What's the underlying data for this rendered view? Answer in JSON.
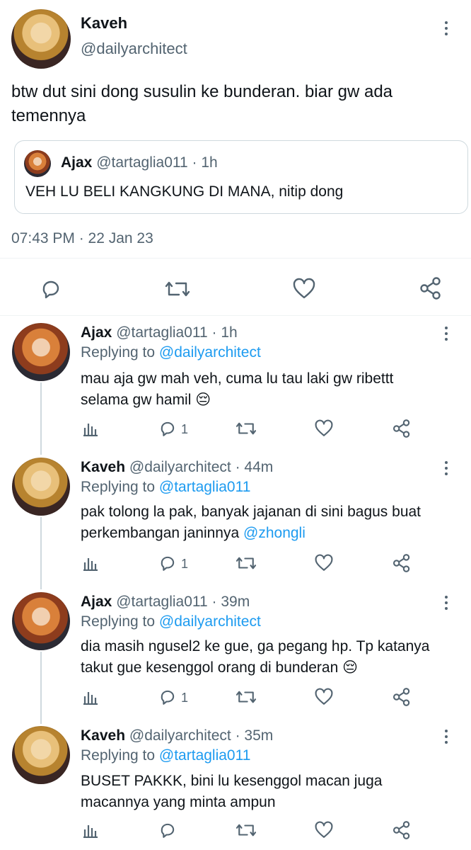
{
  "tweet": {
    "author_name": "Kaveh",
    "author_handle": "@dailyarchitect",
    "text": "btw dut sini dong susulin ke bunderan. biar gw ada temennya",
    "quote": {
      "name": "Ajax",
      "handle_time": "@tartaglia011 · 1h",
      "text": "VEH LU BELI KANGKUNG DI MANA, nitip dong"
    },
    "timestamp": "07:43 PM · 22 Jan 23"
  },
  "replies": [
    {
      "name": "Ajax",
      "handle_time": "@tartaglia011 · 1h",
      "replying_prefix": "Replying to",
      "replying_to": "@dailyarchitect",
      "text_line1": "mau aja gw mah veh, cuma lu tau laki gw ribettt",
      "text_line2": "selama gw hamil",
      "reply_count": "1",
      "emoji": "😔"
    },
    {
      "name": "Kaveh",
      "handle_time": "@dailyarchitect · 44m",
      "replying_prefix": "Replying to",
      "replying_to": "@tartaglia011",
      "text_line1": "pak tolong la pak, banyak jajanan di sini bagus buat",
      "text_line2": "perkembangan janinnya",
      "mention": "@zhongli",
      "reply_count": "1"
    },
    {
      "name": "Ajax",
      "handle_time": "@tartaglia011 · 39m",
      "replying_prefix": "Replying to",
      "replying_to": "@dailyarchitect",
      "text_line1": "dia masih ngusel2 ke gue, ga pegang hp. Tp katanya",
      "text_line2": "takut gue kesenggol orang di bunderan",
      "reply_count": "1",
      "emoji": "😔"
    },
    {
      "name": "Kaveh",
      "handle_time": "@dailyarchitect · 35m",
      "replying_prefix": "Replying to",
      "replying_to": "@tartaglia011",
      "text_line1": "BUSET PAKKK, bini lu kesenggol macan juga",
      "text_line2": "macannya yang minta ampun"
    }
  ],
  "colors": {
    "link": "#1d9bf0",
    "muted": "#536471",
    "text": "#0f1419",
    "border": "#cfd9de"
  }
}
